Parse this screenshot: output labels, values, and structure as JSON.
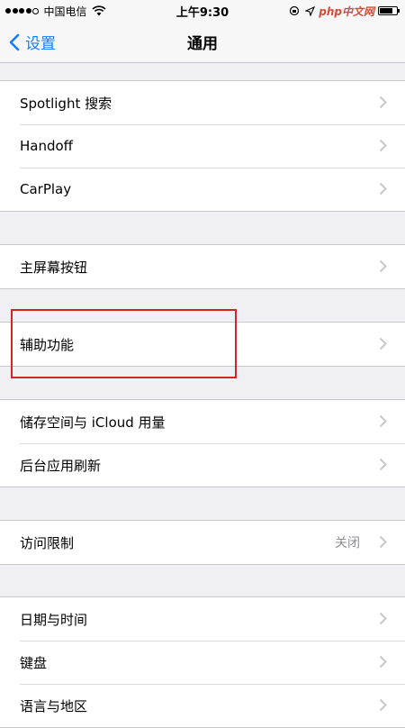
{
  "status_bar": {
    "carrier": "中国电信",
    "time": "上午9:30",
    "watermark": "php中文网"
  },
  "nav": {
    "back_label": "设置",
    "title": "通用"
  },
  "groups": [
    {
      "items": [
        {
          "label": "Spotlight 搜索"
        },
        {
          "label": "Handoff"
        },
        {
          "label": "CarPlay"
        }
      ]
    },
    {
      "items": [
        {
          "label": "主屏幕按钮"
        }
      ]
    },
    {
      "items": [
        {
          "label": "辅助功能"
        }
      ]
    },
    {
      "items": [
        {
          "label": "储存空间与 iCloud 用量"
        },
        {
          "label": "后台应用刷新"
        }
      ]
    },
    {
      "items": [
        {
          "label": "访问限制",
          "value": "关闭"
        }
      ]
    },
    {
      "items": [
        {
          "label": "日期与时间"
        },
        {
          "label": "键盘"
        },
        {
          "label": "语言与地区"
        }
      ]
    }
  ],
  "colors": {
    "accent": "#157efb",
    "highlight": "#d62424",
    "background": "#efeff4"
  }
}
